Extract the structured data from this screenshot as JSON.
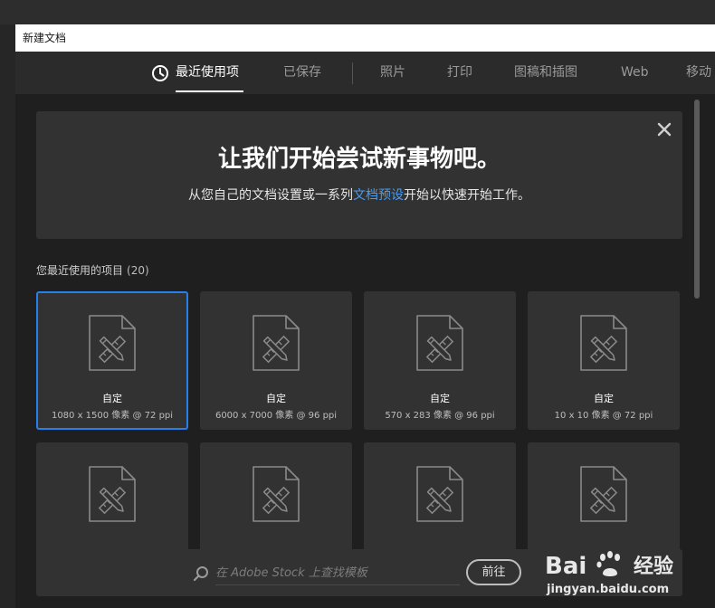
{
  "window": {
    "title": "新建文档"
  },
  "tabs": [
    {
      "label": "最近使用项",
      "active": true
    },
    {
      "label": "已保存"
    },
    {
      "label": "照片"
    },
    {
      "label": "打印"
    },
    {
      "label": "图稿和插图"
    },
    {
      "label": "Web"
    },
    {
      "label": "移动"
    }
  ],
  "welcome": {
    "title": "让我们开始尝试新事物吧。",
    "subtitle_before": "从您自己的文档设置或一系列",
    "subtitle_link": "文档预设",
    "subtitle_after": "开始以快速开始工作。"
  },
  "recent": {
    "label": "您最近使用的项目",
    "count": "(20)",
    "items": [
      {
        "name": "自定",
        "meta": "1080 x 1500 像素 @ 72 ppi",
        "selected": true
      },
      {
        "name": "自定",
        "meta": "6000 x 7000 像素 @ 96 ppi"
      },
      {
        "name": "自定",
        "meta": "570 x 283 像素 @ 96 ppi"
      },
      {
        "name": "自定",
        "meta": "10 x 10 像素 @ 72 ppi"
      },
      {
        "name": "",
        "meta": ""
      },
      {
        "name": "",
        "meta": ""
      },
      {
        "name": "",
        "meta": ""
      },
      {
        "name": "",
        "meta": ""
      }
    ]
  },
  "stock": {
    "placeholder": "在 Adobe Stock 上查找模板",
    "go_label": "前往"
  },
  "watermark": {
    "brand": "经验",
    "url": "jingyan.baidu.com"
  },
  "colors": {
    "accent": "#2680eb",
    "link": "#4a9cf0",
    "panel": "#323232",
    "background": "#1f1f1f"
  }
}
